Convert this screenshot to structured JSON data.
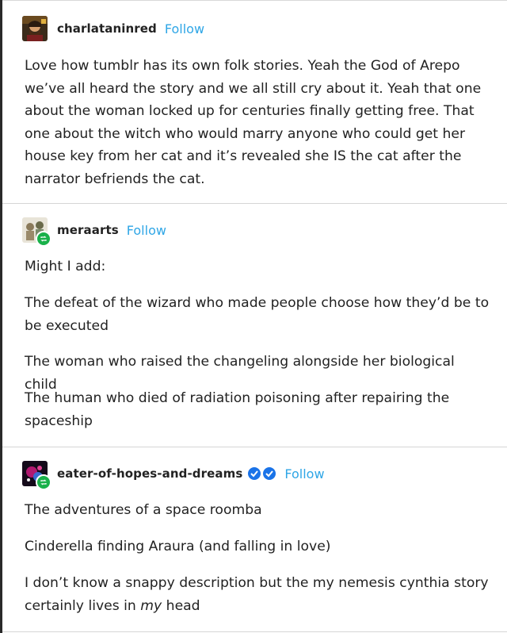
{
  "posts": [
    {
      "username": "charlataninred",
      "follow_label": "Follow",
      "paragraphs": [
        "Love how tumblr has its own folk stories. Yeah the God of Arepo we’ve all heard the story and we all still cry about it. Yeah that one about the woman locked up for centuries finally getting free. That one about the witch who would marry anyone who could get her house key from her cat and it’s revealed she IS the cat after the narrator befriends the cat."
      ]
    },
    {
      "username": "meraarts",
      "follow_label": "Follow",
      "paragraphs": [
        "Might I add:",
        "The defeat of the wizard who made people choose how they’d be to be executed",
        "The woman who raised the changeling alongside her biological child",
        "The human who died of radiation poisoning after repairing the spaceship"
      ]
    },
    {
      "username": "eater-of-hopes-and-dreams",
      "follow_label": "Follow",
      "paragraphs": [
        "The adventures of a space roomba",
        "Cinderella finding Araura (and falling in love)"
      ],
      "last_paragraph": {
        "before": "I don’t know a snappy description but the my nemesis cynthia story certainly lives in ",
        "emphasis": "my",
        "after": " head"
      }
    }
  ],
  "colors": {
    "follow": "#2fa6e6",
    "reblog_badge": "#19b14a",
    "verified_badge": "#1a73e8"
  },
  "icons": [
    "reblog-icon",
    "verified-badge-icon"
  ]
}
